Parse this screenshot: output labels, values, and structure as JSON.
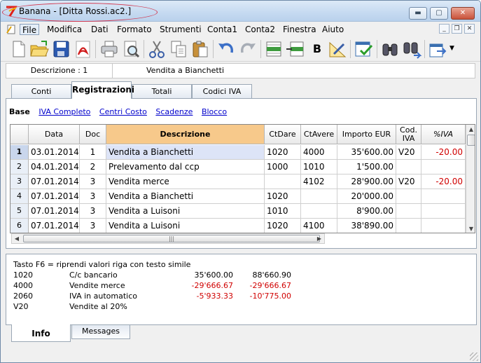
{
  "window": {
    "title": "Banana - [Ditta Rossi.ac2.]"
  },
  "menu": [
    "File",
    "Modifica",
    "Dati",
    "Formato",
    "Strumenti",
    "Conta1",
    "Conta2",
    "Finestra",
    "Aiuto"
  ],
  "toolbar_icons": [
    "new-file-icon",
    "open-folder-icon",
    "save-icon",
    "pdf-icon",
    "print-icon",
    "print-preview-icon",
    "cut-icon",
    "copy-icon",
    "paste-icon",
    "undo-icon",
    "redo-icon",
    "insert-row-icon",
    "delete-row-icon",
    "bold-icon",
    "drawing-tools-icon",
    "check-accounting-icon",
    "find-icon",
    "find-next-icon",
    "export-icon"
  ],
  "infobar": {
    "label": "Descrizione : 1",
    "value": "Vendita a Bianchetti"
  },
  "tabs": [
    "Conti",
    "Registrazioni",
    "Totali",
    "Codici IVA"
  ],
  "views": [
    "Base",
    "IVA Completo",
    "Centri Costo",
    "Scadenze",
    "Blocco"
  ],
  "table": {
    "headers": [
      "Data",
      "Doc",
      "Descrizione",
      "CtDare",
      "CtAvere",
      "Importo EUR",
      "Cod. IVA",
      "%IVA"
    ],
    "rows": [
      {
        "n": "1",
        "data": "03.01.2014",
        "doc": "1",
        "descr": "Vendita a Bianchetti",
        "dare": "1020",
        "avere": "4000",
        "importo": "35'600.00",
        "iva": "V20",
        "piva": "-20.00"
      },
      {
        "n": "2",
        "data": "04.01.2014",
        "doc": "2",
        "descr": "Prelevamento dal ccp",
        "dare": "1000",
        "avere": "1010",
        "importo": "1'500.00",
        "iva": "",
        "piva": ""
      },
      {
        "n": "3",
        "data": "07.01.2014",
        "doc": "3",
        "descr": "Vendita merce",
        "dare": "",
        "avere": "4102",
        "importo": "28'900.00",
        "iva": "V20",
        "piva": "-20.00"
      },
      {
        "n": "4",
        "data": "07.01.2014",
        "doc": "3",
        "descr": "Vendita a Bianchetti",
        "dare": "1020",
        "avere": "",
        "importo": "20'000.00",
        "iva": "",
        "piva": ""
      },
      {
        "n": "5",
        "data": "07.01.2014",
        "doc": "3",
        "descr": "Vendita a Luisoni",
        "dare": "1010",
        "avere": "",
        "importo": "8'900.00",
        "iva": "",
        "piva": ""
      },
      {
        "n": "6",
        "data": "07.01.2014",
        "doc": "3",
        "descr": "Vendita a Luisoni",
        "dare": "1020",
        "avere": "4100",
        "importo": "38'890.00",
        "iva": "",
        "piva": ""
      }
    ]
  },
  "info": {
    "hint": "Tasto F6 = riprendi valori riga con testo simile",
    "lines": [
      {
        "code": "1020",
        "name": "C/c bancario",
        "v1": "35'600.00",
        "v2": "88'660.90",
        "neg1": false,
        "neg2": false
      },
      {
        "code": "4000",
        "name": "Vendite merce",
        "v1": "-29'666.67",
        "v2": "-29'666.67",
        "neg1": true,
        "neg2": true
      },
      {
        "code": "2060",
        "name": "IVA in automatico",
        "v1": "-5'933.33",
        "v2": "-10'775.00",
        "neg1": true,
        "neg2": true
      },
      {
        "code": "V20",
        "name": "Vendite al 20%",
        "v1": "",
        "v2": "",
        "neg1": false,
        "neg2": false
      }
    ]
  },
  "bottom_tabs": [
    "Info",
    "Messages"
  ],
  "colors": {
    "negative": "#d00000",
    "highlight_header": "#f7c98b",
    "row_highlight": "#dde4f7"
  }
}
